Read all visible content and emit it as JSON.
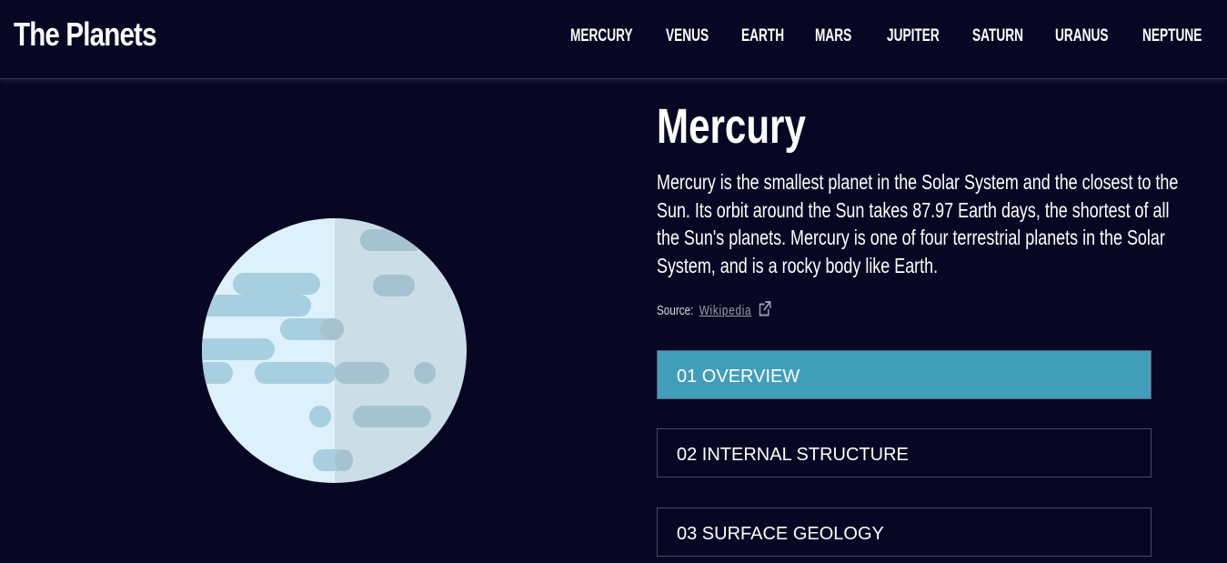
{
  "header": {
    "logo": "The Planets",
    "nav": [
      "MERCURY",
      "VENUS",
      "EARTH",
      "MARS",
      "JUPITER",
      "SATURN",
      "URANUS",
      "NEPTUNE"
    ]
  },
  "planet": {
    "name": "Mercury",
    "description": "Mercury is the smallest planet in the Solar System and the closest to the Sun. Its orbit around the Sun takes 87.97 Earth days, the shortest of all the Sun's planets. Mercury is one of four terrestrial planets in the Solar System, and is a rocky body like Earth.",
    "source_label": "Source:",
    "source_link": "Wikipedia",
    "image_icon": "mercury-planet-icon"
  },
  "tabs": [
    {
      "label": "01 OVERVIEW",
      "active": true
    },
    {
      "label": "02 INTERNAL STRUCTURE",
      "active": false
    },
    {
      "label": "03 SURFACE GEOLOGY",
      "active": false
    }
  ],
  "colors": {
    "background": "#070724",
    "accent": "#419ebb",
    "border": "#38384f"
  }
}
